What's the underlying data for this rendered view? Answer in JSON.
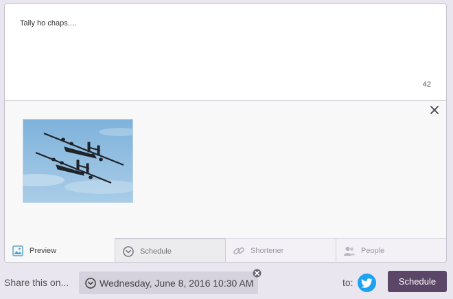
{
  "composer": {
    "text": "Tally ho chaps....",
    "char_count": "42"
  },
  "tabs": [
    {
      "label": "Preview",
      "icon": "image-icon",
      "active": true
    },
    {
      "label": "Schedule",
      "icon": "clock-icon"
    },
    {
      "label": "Shortener",
      "icon": "link-icon"
    },
    {
      "label": "People",
      "icon": "people-icon"
    }
  ],
  "footer": {
    "share_label": "Share this on...",
    "schedule_date": "Wednesday, June 8, 2016 10:30 AM",
    "to_label": "to:",
    "account_icon": "twitter-icon",
    "schedule_button": "Schedule"
  },
  "colors": {
    "accent": "#5b4668",
    "twitter": "#1da1f2",
    "background": "#e9e6ef"
  }
}
